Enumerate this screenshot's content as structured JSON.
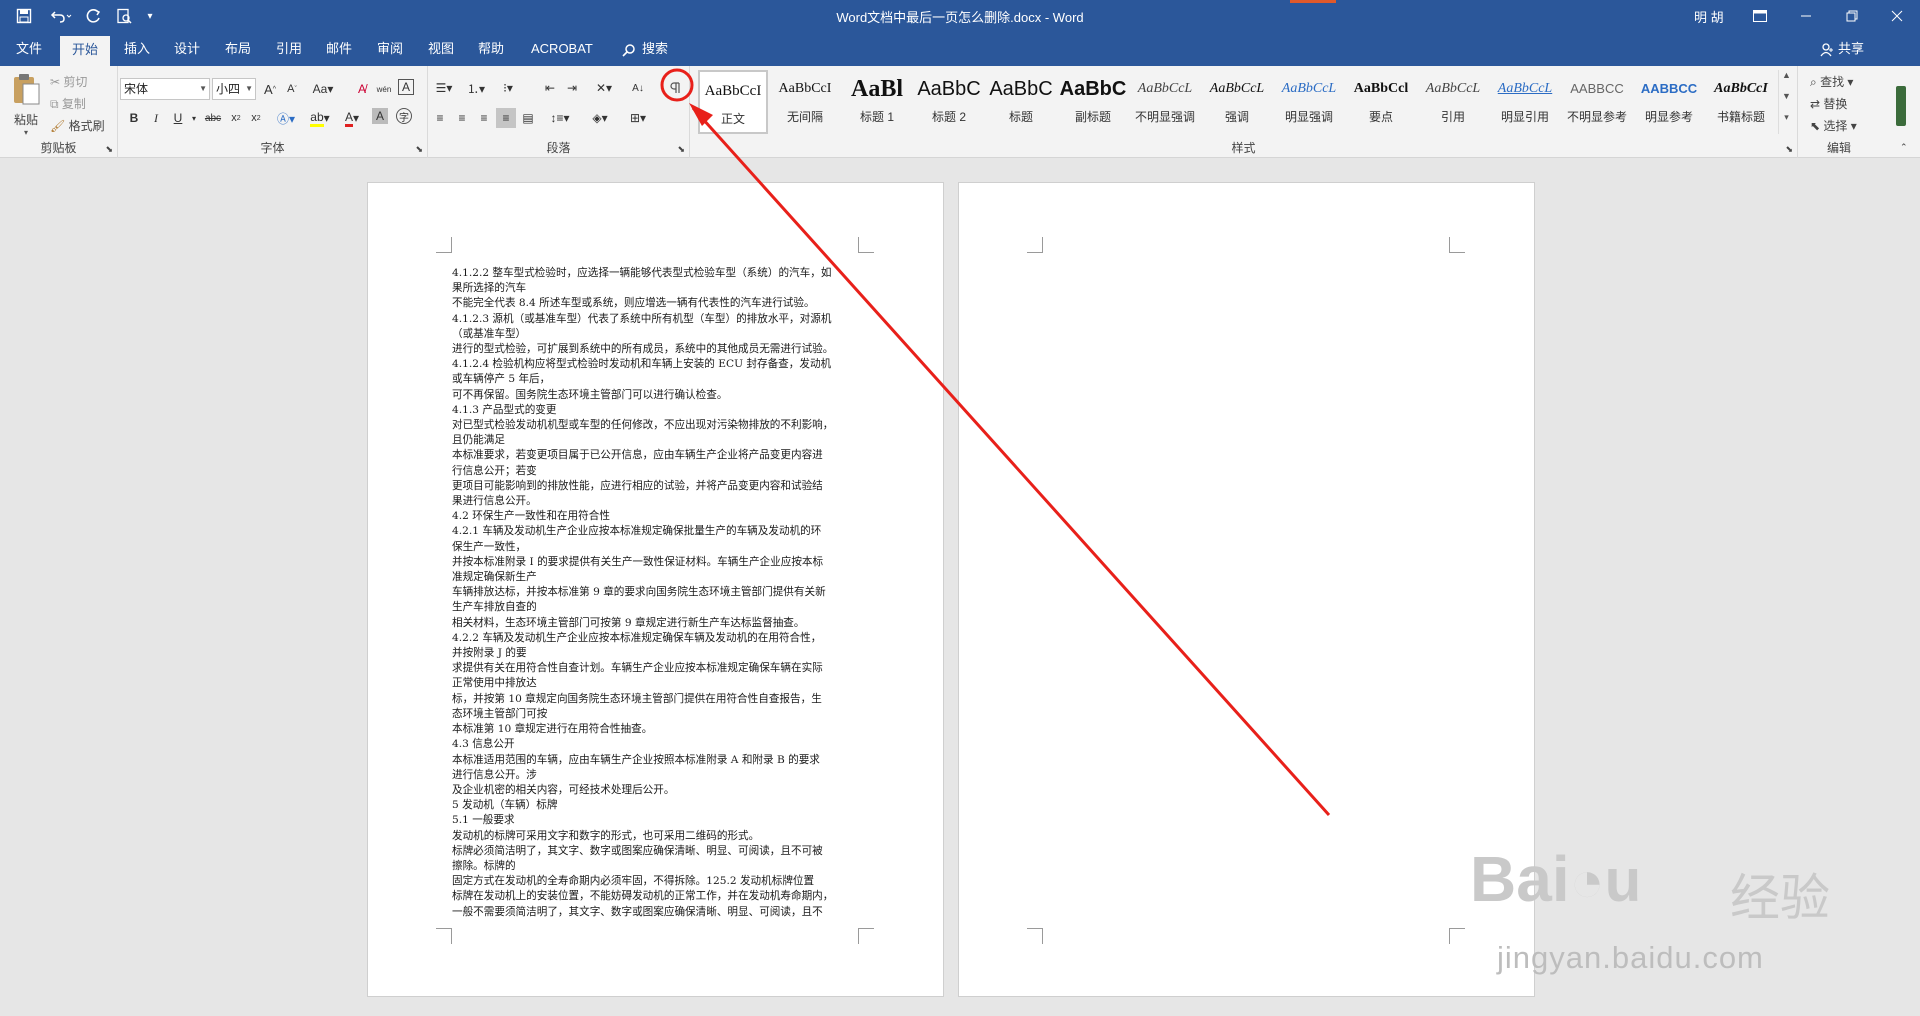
{
  "titlebar": {
    "title": "Word文档中最后一页怎么删除.docx  -  Word",
    "user": "明 胡",
    "qat_save": "save-icon",
    "qat_undo": "undo-icon",
    "qat_redo": "redo-icon",
    "qat_preview": "print-preview-icon"
  },
  "tabs": [
    {
      "label": "文件"
    },
    {
      "label": "开始"
    },
    {
      "label": "插入"
    },
    {
      "label": "设计"
    },
    {
      "label": "布局"
    },
    {
      "label": "引用"
    },
    {
      "label": "邮件"
    },
    {
      "label": "审阅"
    },
    {
      "label": "视图"
    },
    {
      "label": "帮助"
    },
    {
      "label": "ACROBAT"
    },
    {
      "label": "搜索"
    }
  ],
  "share_label": "共享",
  "clipboard": {
    "paste": "粘贴",
    "cut": "剪切",
    "copy": "复制",
    "format_painter": "格式刷",
    "group": "剪贴板"
  },
  "font": {
    "name": "宋体",
    "size": "小四",
    "group": "字体"
  },
  "paragraph": {
    "group": "段落"
  },
  "styles": {
    "group": "样式",
    "items": [
      {
        "preview": "AaBbCcI",
        "name": "正文"
      },
      {
        "preview": "AaBbCcI",
        "name": "无间隔"
      },
      {
        "preview": "AaBl",
        "name": "标题 1"
      },
      {
        "preview": "AaBbC",
        "name": "标题 2"
      },
      {
        "preview": "AaBbC",
        "name": "标题"
      },
      {
        "preview": "AaBbC",
        "name": "副标题"
      },
      {
        "preview": "AaBbCcL",
        "name": "不明显强调"
      },
      {
        "preview": "AaBbCcL",
        "name": "强调"
      },
      {
        "preview": "AaBbCcL",
        "name": "明显强调"
      },
      {
        "preview": "AaBbCcl",
        "name": "要点"
      },
      {
        "preview": "AaBbCcL",
        "name": "引用"
      },
      {
        "preview": "AaBbCcL",
        "name": "明显引用"
      },
      {
        "preview": "AABBCC",
        "name": "不明显参考"
      },
      {
        "preview": "AABBCC",
        "name": "明显参考"
      },
      {
        "preview": "AaBbCcI",
        "name": "书籍标题"
      }
    ]
  },
  "editing": {
    "find": "查找",
    "replace": "替换",
    "select": "选择",
    "group": "编辑"
  },
  "document": {
    "lines": [
      "4.1.2.2 整车型式检验时，应选择一辆能够代表型式检验车型（系统）的汽车，如",
      "果所选择的汽车",
      "不能完全代表 8.4 所述车型或系统，则应增选一辆有代表性的汽车进行试验。",
      "4.1.2.3 源机（或基准车型）代表了系统中所有机型（车型）的排放水平，对源机",
      "（或基准车型）",
      "进行的型式检验，可扩展到系统中的所有成员，系统中的其他成员无需进行试验。",
      "4.1.2.4 检验机构应将型式检验时发动机和车辆上安装的 ECU 封存备查，发动机",
      "或车辆停产 5 年后，",
      "可不再保留。国务院生态环境主管部门可以进行确认检查。",
      "4.1.3 产品型式的变更",
      "对已型式检验发动机机型或车型的任何修改，不应出现对污染物排放的不利影响，",
      "且仍能满足",
      "本标准要求，若变更项目属于已公开信息，应由车辆生产企业将产品变更内容进",
      "行信息公开；若变",
      "更项目可能影响到的排放性能，应进行相应的试验，并将产品变更内容和试验结",
      "果进行信息公开。",
      "4.2 环保生产一致性和在用符合性",
      "4.2.1  车辆及发动机生产企业应按本标准规定确保批量生产的车辆及发动机的环",
      "保生产一致性，",
      "并按本标准附录 I 的要求提供有关生产一致性保证材料。车辆生产企业应按本标",
      "准规定确保新生产",
      "车辆排放达标，并按本标准第 9 章的要求向国务院生态环境主管部门提供有关新",
      "生产车排放自查的",
      "相关材料，生态环境主管部门可按第 9 章规定进行新生产车达标监督抽查。",
      "4.2.2  车辆及发动机生产企业应按本标准规定确保车辆及发动机的在用符合性，",
      "并按附录 J 的要",
      "求提供有关在用符合性自查计划。车辆生产企业应按本标准规定确保车辆在实际",
      "正常使用中排放达",
      "标，并按第 10 章规定向国务院生态环境主管部门提供在用符合性自查报告，生",
      "态环境主管部门可按",
      "本标准第 10 章规定进行在用符合性抽查。",
      "4.3 信息公开",
      "本标准适用范围的车辆，应由车辆生产企业按照本标准附录 A 和附录 B 的要求",
      "进行信息公开。涉",
      "及企业机密的相关内容，可经技术处理后公开。",
      "5 发动机（车辆）标牌",
      "5.1 一般要求",
      "发动机的标牌可采用文字和数字的形式，也可采用二维码的形式。",
      "标牌必须简洁明了，其文字、数字或图案应确保清晰、明显、可阅读，且不可被",
      "擦除。标牌的",
      "固定方式在发动机的全寿命期内必须牢固，不得拆除。125.2 发动机标牌位置",
      "标牌在发动机上的安装位置，不能妨碍发动机的正常工作，并在发动机寿命期内，",
      "一般不需要须简洁明了，其文字、数字或图案应确保清晰、明显、可阅读，且不"
    ]
  },
  "watermark": {
    "brand": "Bai",
    "brand2": "经验",
    "url": "jingyan.baidu.com"
  },
  "colors": {
    "accent": "#2b579a",
    "annotation": "#e8201a"
  }
}
